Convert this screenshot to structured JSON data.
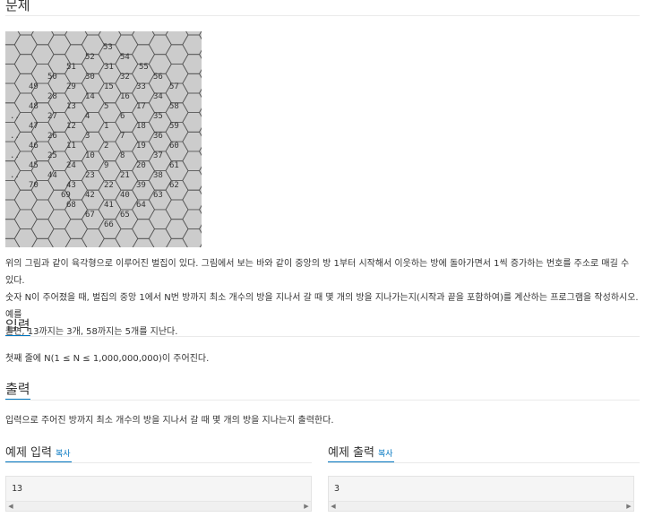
{
  "problem": {
    "title": "문제",
    "description_lines": [
      "위의 그림과 같이 육각형으로 이루어진 벌집이 있다. 그림에서 보는 바와 같이 중앙의 방 1부터 시작해서 이웃하는 방에 돌아가면서 1씩 증가하는 번호를 주소로 매길 수 있다.",
      "숫자 N이 주어졌을 때, 벌집의 중앙 1에서 N번 방까지 최소 개수의 방을 지나서 갈 때 몇 개의 방을 지나가는지(시작과 끝을 포함하여)를 계산하는 프로그램을 작성하시오. 예를",
      "들면, 13까지는 3개, 58까지는 5개를 지난다."
    ]
  },
  "figure": {
    "labels": [
      {
        "t": "53"
      },
      {
        "t": "52"
      },
      {
        "t": "54"
      },
      {
        "t": "51"
      },
      {
        "t": "31"
      },
      {
        "t": "55"
      },
      {
        "t": "50"
      },
      {
        "t": "30"
      },
      {
        "t": "32"
      },
      {
        "t": "56"
      },
      {
        "t": "49"
      },
      {
        "t": "29"
      },
      {
        "t": "15"
      },
      {
        "t": "33"
      },
      {
        "t": "57"
      },
      {
        "t": "28"
      },
      {
        "t": "14"
      },
      {
        "t": "16"
      },
      {
        "t": "34"
      },
      {
        "t": "48"
      },
      {
        "t": "13"
      },
      {
        "t": "5"
      },
      {
        "t": "17"
      },
      {
        "t": "58"
      },
      {
        "t": ".."
      },
      {
        "t": "27"
      },
      {
        "t": "4"
      },
      {
        "t": "6"
      },
      {
        "t": "35"
      },
      {
        "t": "47"
      },
      {
        "t": "12"
      },
      {
        "t": "1"
      },
      {
        "t": "18"
      },
      {
        "t": "59"
      },
      {
        "t": ".."
      },
      {
        "t": "26"
      },
      {
        "t": "3"
      },
      {
        "t": "7"
      },
      {
        "t": "36"
      },
      {
        "t": "46"
      },
      {
        "t": "11"
      },
      {
        "t": "2"
      },
      {
        "t": "19"
      },
      {
        "t": "60"
      },
      {
        "t": ".."
      },
      {
        "t": "25"
      },
      {
        "t": "10"
      },
      {
        "t": "8"
      },
      {
        "t": "37"
      },
      {
        "t": "45"
      },
      {
        "t": "24"
      },
      {
        "t": "9"
      },
      {
        "t": "20"
      },
      {
        "t": "61"
      },
      {
        "t": ".."
      },
      {
        "t": "44"
      },
      {
        "t": "23"
      },
      {
        "t": "21"
      },
      {
        "t": "38"
      },
      {
        "t": "70"
      },
      {
        "t": "43"
      },
      {
        "t": "22"
      },
      {
        "t": "39"
      },
      {
        "t": "62"
      },
      {
        "t": "69"
      },
      {
        "t": "42"
      },
      {
        "t": "40"
      },
      {
        "t": "63"
      },
      {
        "t": "68"
      },
      {
        "t": "41"
      },
      {
        "t": "64"
      },
      {
        "t": "67"
      },
      {
        "t": "65"
      },
      {
        "t": "66"
      }
    ]
  },
  "input": {
    "title": "입력",
    "description": "첫째 줄에 N(1 ≤ N ≤ 1,000,000,000)이 주어진다."
  },
  "output": {
    "title": "출력",
    "description": "입력으로 주어진 방까지 최소 개수의 방을 지나서 갈 때 몇 개의 방을 지나는지 출력한다."
  },
  "sample_input": {
    "title": "예제 입력",
    "copy_label": "복사",
    "value": "13"
  },
  "sample_output": {
    "title": "예제 출력",
    "copy_label": "복사",
    "value": "3"
  }
}
